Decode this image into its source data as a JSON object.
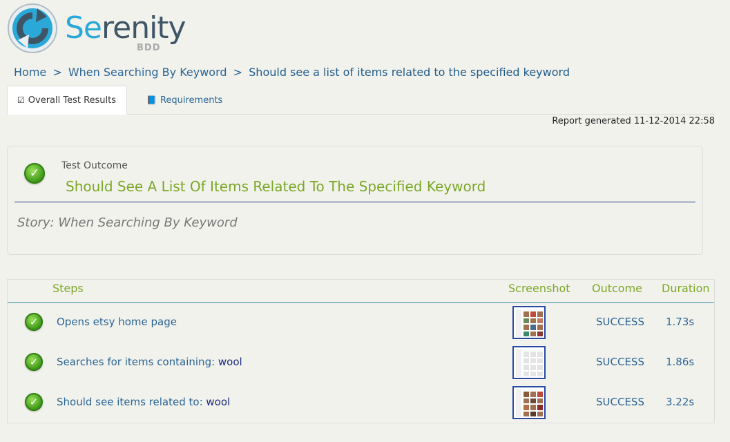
{
  "logo": {
    "word_se": "Se",
    "word_rest": "renity",
    "sub": "BDD"
  },
  "breadcrumb": {
    "home": "Home",
    "sep": ">",
    "story": "When Searching By Keyword",
    "current": "Should see a list of items related to the specified keyword"
  },
  "tabs": {
    "overall": "Overall Test Results",
    "requirements": "Requirements"
  },
  "report": {
    "generated": "Report generated 11-12-2014 22:58"
  },
  "outcome": {
    "label": "Test Outcome",
    "title": "Should See A List Of Items Related To The Specified Keyword",
    "story": "Story: When Searching By Keyword",
    "status_color": "#7aa726"
  },
  "steps": {
    "headers": {
      "steps": "Steps",
      "screenshot": "Screenshot",
      "outcome": "Outcome",
      "duration": "Duration"
    },
    "rows": [
      {
        "text": "Opens etsy home page",
        "keyword": "",
        "outcome": "SUCCESS",
        "duration": "1.73s"
      },
      {
        "text": "Searches for items containing: ",
        "keyword": "wool",
        "outcome": "SUCCESS",
        "duration": "1.86s"
      },
      {
        "text": "Should see items related to: ",
        "keyword": "wool",
        "outcome": "SUCCESS",
        "duration": "3.22s"
      }
    ]
  },
  "icons": {
    "check": "check-circle-icon",
    "tab_overall": "checkbox-icon",
    "tab_requirements": "book-icon"
  }
}
